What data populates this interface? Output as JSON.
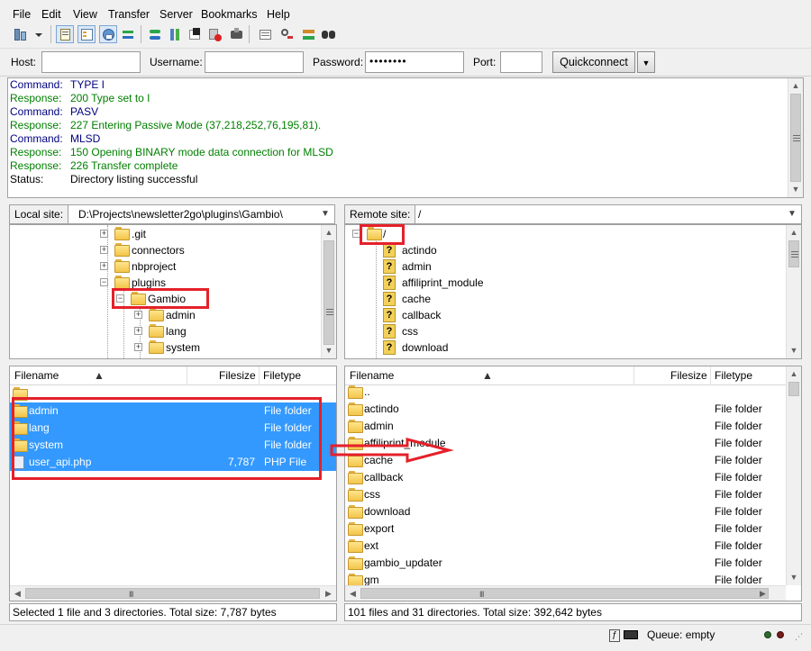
{
  "menu": [
    "File",
    "Edit",
    "View",
    "Transfer",
    "Server",
    "Bookmarks",
    "Help"
  ],
  "toolbar": {
    "icons": [
      "site-manager-icon",
      "dropdown-arrow-icon",
      "toggle-log-icon",
      "toggle-local-tree-icon",
      "toggle-remote-tree-icon",
      "toggle-queue-icon",
      "refresh-icon",
      "process-queue-icon",
      "cancel-icon",
      "disconnect-icon",
      "reconnect-icon",
      "filter-icon",
      "compare-icon",
      "sync-browse-icon",
      "search-icon"
    ]
  },
  "quickconnect": {
    "host_label": "Host:",
    "host_value": "",
    "username_label": "Username:",
    "username_value": "",
    "password_label": "Password:",
    "password_value": "••••••••",
    "port_label": "Port:",
    "port_value": "",
    "button_label": "Quickconnect"
  },
  "log": [
    {
      "kind": "Command:",
      "text": "TYPE I",
      "color": "#000080"
    },
    {
      "kind": "Response:",
      "text": "200 Type set to I",
      "color": "#008000"
    },
    {
      "kind": "Command:",
      "text": "PASV",
      "color": "#000080"
    },
    {
      "kind": "Response:",
      "text": "227 Entering Passive Mode (37,218,252,76,195,81).",
      "color": "#008000"
    },
    {
      "kind": "Command:",
      "text": "MLSD",
      "color": "#000080"
    },
    {
      "kind": "Response:",
      "text": "150 Opening BINARY mode data connection for MLSD",
      "color": "#008000"
    },
    {
      "kind": "Response:",
      "text": "226 Transfer complete",
      "color": "#008000"
    },
    {
      "kind": "Status:",
      "text": "Directory listing successful",
      "color": "#000000"
    }
  ],
  "local": {
    "site_label": "Local site:",
    "path": "D:\\Projects\\newsletter2go\\plugins\\Gambio\\",
    "tree": [
      {
        "label": ".git",
        "exp": "+"
      },
      {
        "label": "connectors",
        "exp": "+"
      },
      {
        "label": "nbproject",
        "exp": "+"
      },
      {
        "label": "plugins",
        "exp": "−"
      },
      {
        "label": "Gambio",
        "exp": "−"
      },
      {
        "label": "admin",
        "exp": "+"
      },
      {
        "label": "lang",
        "exp": "+"
      },
      {
        "label": "system",
        "exp": "+"
      }
    ],
    "headers": {
      "name": "Filename",
      "size": "Filesize",
      "type": "Filetype"
    },
    "files": [
      {
        "name": "..",
        "size": "",
        "type": ""
      },
      {
        "name": "admin",
        "size": "",
        "type": "File folder"
      },
      {
        "name": "lang",
        "size": "",
        "type": "File folder"
      },
      {
        "name": "system",
        "size": "",
        "type": "File folder"
      },
      {
        "name": "user_api.php",
        "size": "7,787",
        "type": "PHP File"
      }
    ],
    "status": "Selected 1 file and 3 directories. Total size: 7,787 bytes"
  },
  "remote": {
    "site_label": "Remote site:",
    "path": "/",
    "tree_root": "/",
    "tree": [
      "actindo",
      "admin",
      "affiliprint_module",
      "cache",
      "callback",
      "css",
      "download"
    ],
    "headers": {
      "name": "Filename",
      "size": "Filesize",
      "type": "Filetype"
    },
    "files": [
      {
        "name": "..",
        "type": ""
      },
      {
        "name": "actindo",
        "type": "File folder"
      },
      {
        "name": "admin",
        "type": "File folder"
      },
      {
        "name": "affiliprint_module",
        "type": "File folder"
      },
      {
        "name": "cache",
        "type": "File folder"
      },
      {
        "name": "callback",
        "type": "File folder"
      },
      {
        "name": "css",
        "type": "File folder"
      },
      {
        "name": "download",
        "type": "File folder"
      },
      {
        "name": "export",
        "type": "File folder"
      },
      {
        "name": "ext",
        "type": "File folder"
      },
      {
        "name": "gambio_updater",
        "type": "File folder"
      },
      {
        "name": "gm",
        "type": "File folder"
      }
    ],
    "status": "101 files and 31 directories. Total size: 392,642 bytes"
  },
  "statusbar": {
    "queue": "Queue: empty"
  },
  "colors": {
    "selection": "#3399ff",
    "annotation_red": "#e5202a"
  }
}
